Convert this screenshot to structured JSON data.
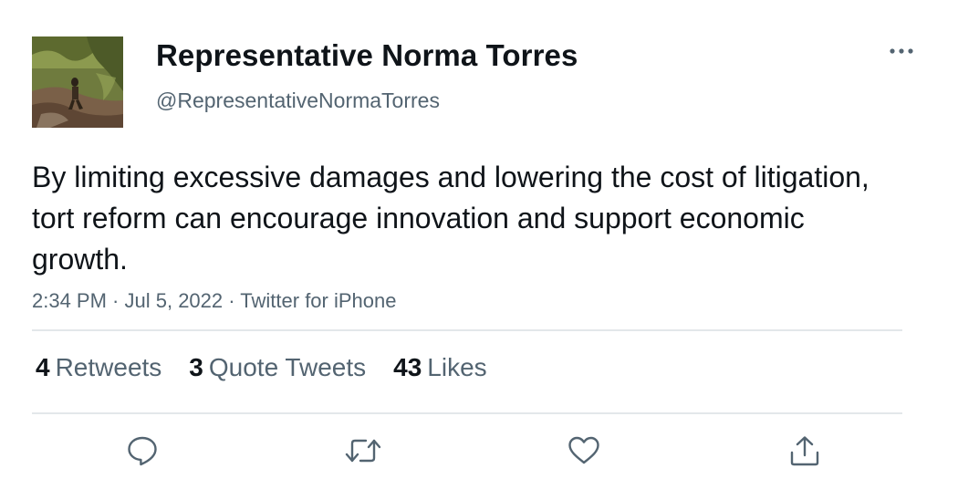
{
  "tweet": {
    "author": {
      "display_name": "Representative Norma Torres",
      "handle": "@RepresentativeNormaTorres",
      "avatar_icon": "profile-photo-avatar"
    },
    "text": "By limiting excessive damages and lowering the cost of litigation, tort reform can encourage innovation and support economic growth.",
    "time": "2:34 PM",
    "separator": " · ",
    "date": "Jul 5, 2022",
    "source": "Twitter for iPhone",
    "stats": {
      "retweets_count": "4",
      "retweets_label": "Retweets",
      "quotes_count": "3",
      "quotes_label": "Quote Tweets",
      "likes_count": "43",
      "likes_label": "Likes"
    },
    "actions": [
      {
        "name": "reply",
        "icon": "speech-bubble-icon"
      },
      {
        "name": "retweet",
        "icon": "retweet-arrows-icon"
      },
      {
        "name": "like",
        "icon": "heart-icon"
      },
      {
        "name": "share",
        "icon": "share-upload-icon"
      }
    ],
    "more_icon": "ellipsis-icon"
  },
  "colors": {
    "text_primary": "#0f1419",
    "text_secondary": "#536471",
    "icon": "#536471",
    "divider": "#e3e7ea",
    "background": "#ffffff"
  }
}
